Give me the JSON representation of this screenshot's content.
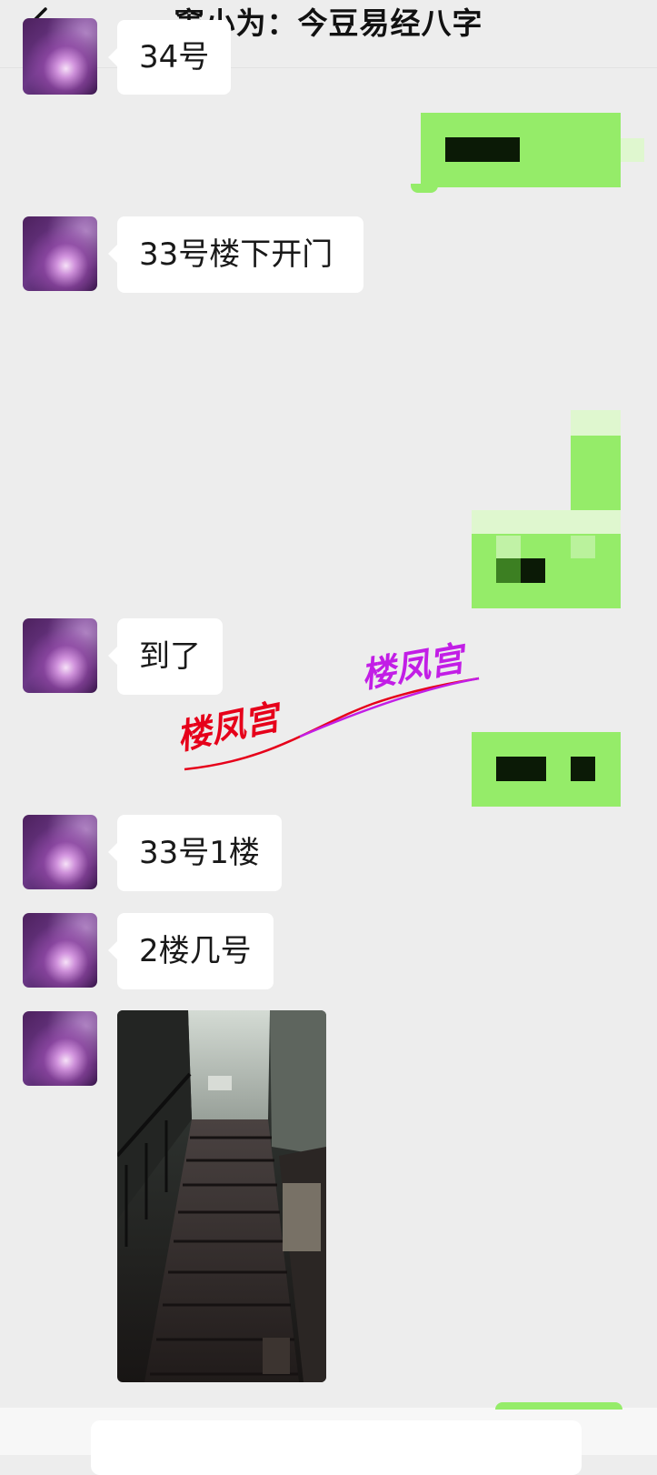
{
  "header": {
    "title": "窦小为：今豆易经八字",
    "back_icon": "chevron-left-icon"
  },
  "messages": [
    {
      "side": "left",
      "text": "34号"
    },
    {
      "side": "right",
      "text": ""
    },
    {
      "side": "left",
      "text": "33号楼下开门"
    },
    {
      "side": "right",
      "text": ""
    },
    {
      "side": "left",
      "text": "到了"
    },
    {
      "side": "right",
      "text": ""
    },
    {
      "side": "left",
      "text": "33号1楼"
    },
    {
      "side": "left",
      "text": "2楼几号"
    },
    {
      "side": "left",
      "image": "staircase-photo"
    }
  ],
  "watermark": {
    "text_red": "楼凤宫",
    "text_purple": "楼凤宫",
    "color_red": "#e6001a",
    "color_purple": "#c21ee6"
  },
  "colors": {
    "background": "#ededed",
    "bubble_incoming": "#ffffff",
    "bubble_outgoing": "#95ec69"
  }
}
